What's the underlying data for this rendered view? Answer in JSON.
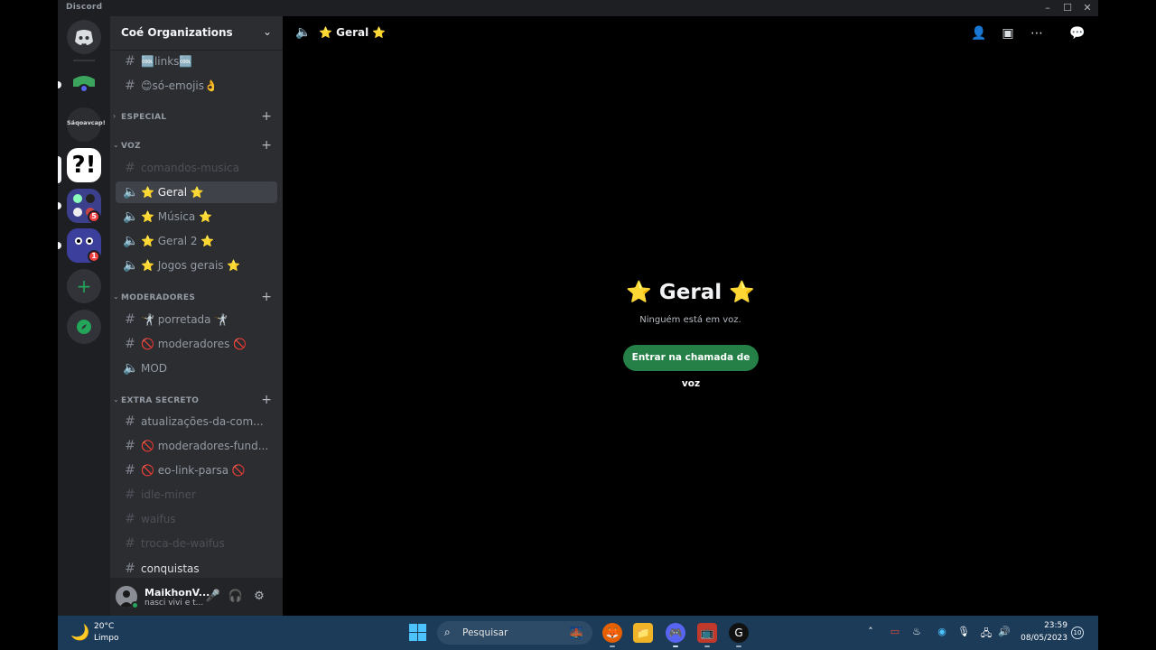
{
  "window": {
    "title": "Discord",
    "minimize": "–",
    "maximize": "☐",
    "close": "✕"
  },
  "rail": {
    "servers": [
      {
        "label": "",
        "icon": "discord-home-icon"
      },
      {
        "label": "",
        "icon": "green-server-icon"
      },
      {
        "label": "Sáqoavcap!",
        "icon": "text-server"
      },
      {
        "label": "?!",
        "icon": "question-exclaim-server"
      },
      {
        "label": "",
        "icon": "group-server",
        "badge": "5"
      },
      {
        "label": "",
        "icon": "eyes-server",
        "badge": "1"
      }
    ],
    "add_label": "+",
    "explore_label": "◈"
  },
  "guild": {
    "name": "Coé Organizations",
    "chevron": "⌄"
  },
  "channels": {
    "top": [
      {
        "icon": "#",
        "name": "🆒links🆒"
      },
      {
        "icon": "#",
        "name": "😊só-emojis👌"
      }
    ],
    "categories": [
      {
        "name": "ESPECIAL",
        "chevron": "›",
        "plus": "+"
      },
      {
        "name": "VOZ",
        "chevron": "⌄",
        "plus": "+"
      },
      {
        "name": "MODERADORES",
        "chevron": "⌄",
        "plus": "+"
      },
      {
        "name": "EXTRA SECRETO",
        "chevron": "⌄",
        "plus": "+"
      }
    ],
    "voz": [
      {
        "icon": "#",
        "name": "comandos-musica"
      },
      {
        "icon": "🔈",
        "name": "⭐ Geral ⭐"
      },
      {
        "icon": "🔈",
        "name": "⭐ Música ⭐"
      },
      {
        "icon": "🔈",
        "name": "⭐ Geral 2 ⭐"
      },
      {
        "icon": "🔈",
        "name": "⭐ Jogos gerais ⭐"
      }
    ],
    "moderadores": [
      {
        "icon": "#",
        "name": "🤺 porretada 🤺"
      },
      {
        "icon": "#",
        "name": "🚫 moderadores 🚫"
      },
      {
        "icon": "🔈",
        "name": "MOD"
      }
    ],
    "extra": [
      {
        "icon": "#",
        "name": "atualizações-da-com..."
      },
      {
        "icon": "#",
        "name": "🚫 moderadores-fund..."
      },
      {
        "icon": "#",
        "name": "🚫 eo-link-parsa 🚫"
      },
      {
        "icon": "#",
        "name": "idle-miner"
      },
      {
        "icon": "#",
        "name": "waifus"
      },
      {
        "icon": "#",
        "name": "troca-de-waifus"
      },
      {
        "icon": "#",
        "name": "conquistas"
      }
    ]
  },
  "user": {
    "name": "MaikhonV...",
    "status": "nasci vivi e t...",
    "mic": "🎤",
    "headset": "🎧",
    "settings": "⚙"
  },
  "header": {
    "icon": "🔈",
    "title": "⭐ Geral ⭐",
    "add_friend": "👤",
    "inbox": "▣",
    "more": "⋯",
    "chat": "💬"
  },
  "voice_panel": {
    "title": "⭐ Geral ⭐",
    "subtitle": "Ninguém está em voz.",
    "join_button": "Entrar na chamada de voz"
  },
  "taskbar": {
    "weather_icon": "🌙",
    "temperature": "20°C",
    "condition": "Limpo",
    "search_icon": "⌕",
    "search_placeholder": "Pesquisar",
    "apps": [
      "🌉",
      "🦊",
      "📁",
      "🎮",
      "📺",
      "G"
    ],
    "tray": [
      "˄",
      "▭",
      "♨",
      "◉",
      "🎙",
      "🖧",
      "🔊"
    ],
    "time": "23:59",
    "date": "08/05/2023",
    "notifications": "10"
  },
  "colors": {
    "accent_green": "#248046",
    "sidebar_bg": "#2b2d31",
    "rail_bg": "#1e1f22",
    "taskbar_bg": "#1c3b58"
  }
}
